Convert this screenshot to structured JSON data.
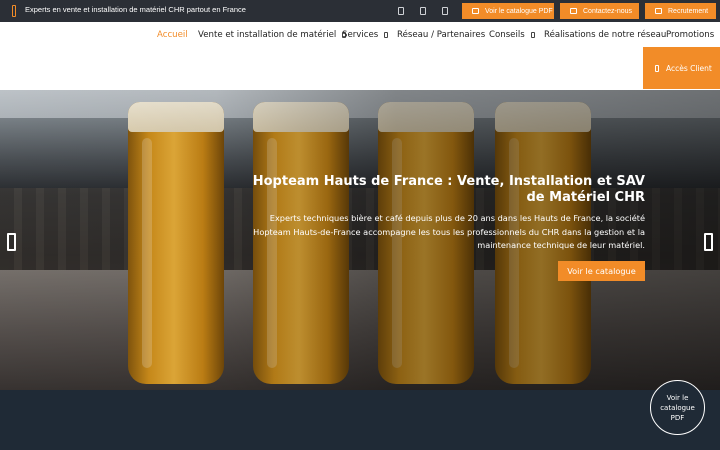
{
  "topbar": {
    "tagline": "Experts en vente et installation de matériel CHR partout en France",
    "buttons": [
      {
        "label": "Voir le catalogue PDF"
      },
      {
        "label": "Contactez-nous"
      },
      {
        "label": "Recrutement"
      }
    ]
  },
  "nav": {
    "items": [
      {
        "label": "Accueil",
        "active": true
      },
      {
        "label": "Vente et installation de matériel",
        "dropdown": true
      },
      {
        "label": "Services",
        "dropdown": true
      },
      {
        "label": "Réseau / Partenaires"
      },
      {
        "label": "Conseils",
        "dropdown": true
      },
      {
        "label": "Réalisations de notre réseau"
      },
      {
        "label": "Promotions"
      }
    ],
    "client_button": "Accès Client"
  },
  "hero": {
    "title": "Hopteam Hauts de France : Vente, Installation et SAV de Matériel CHR",
    "text": "Experts techniques bière et café depuis plus de 20 ans dans les Hauts de France, la société Hopteam Hauts-de-France accompagne les tous les professionnels du CHR dans la gestion et la maintenance technique de leur matériel.",
    "button": "Voir le catalogue"
  },
  "fab": {
    "label": "Voir le catalogue PDF"
  },
  "colors": {
    "accent": "#f28c28",
    "topbar": "#2b2f36",
    "footer": "#1f2a36"
  }
}
